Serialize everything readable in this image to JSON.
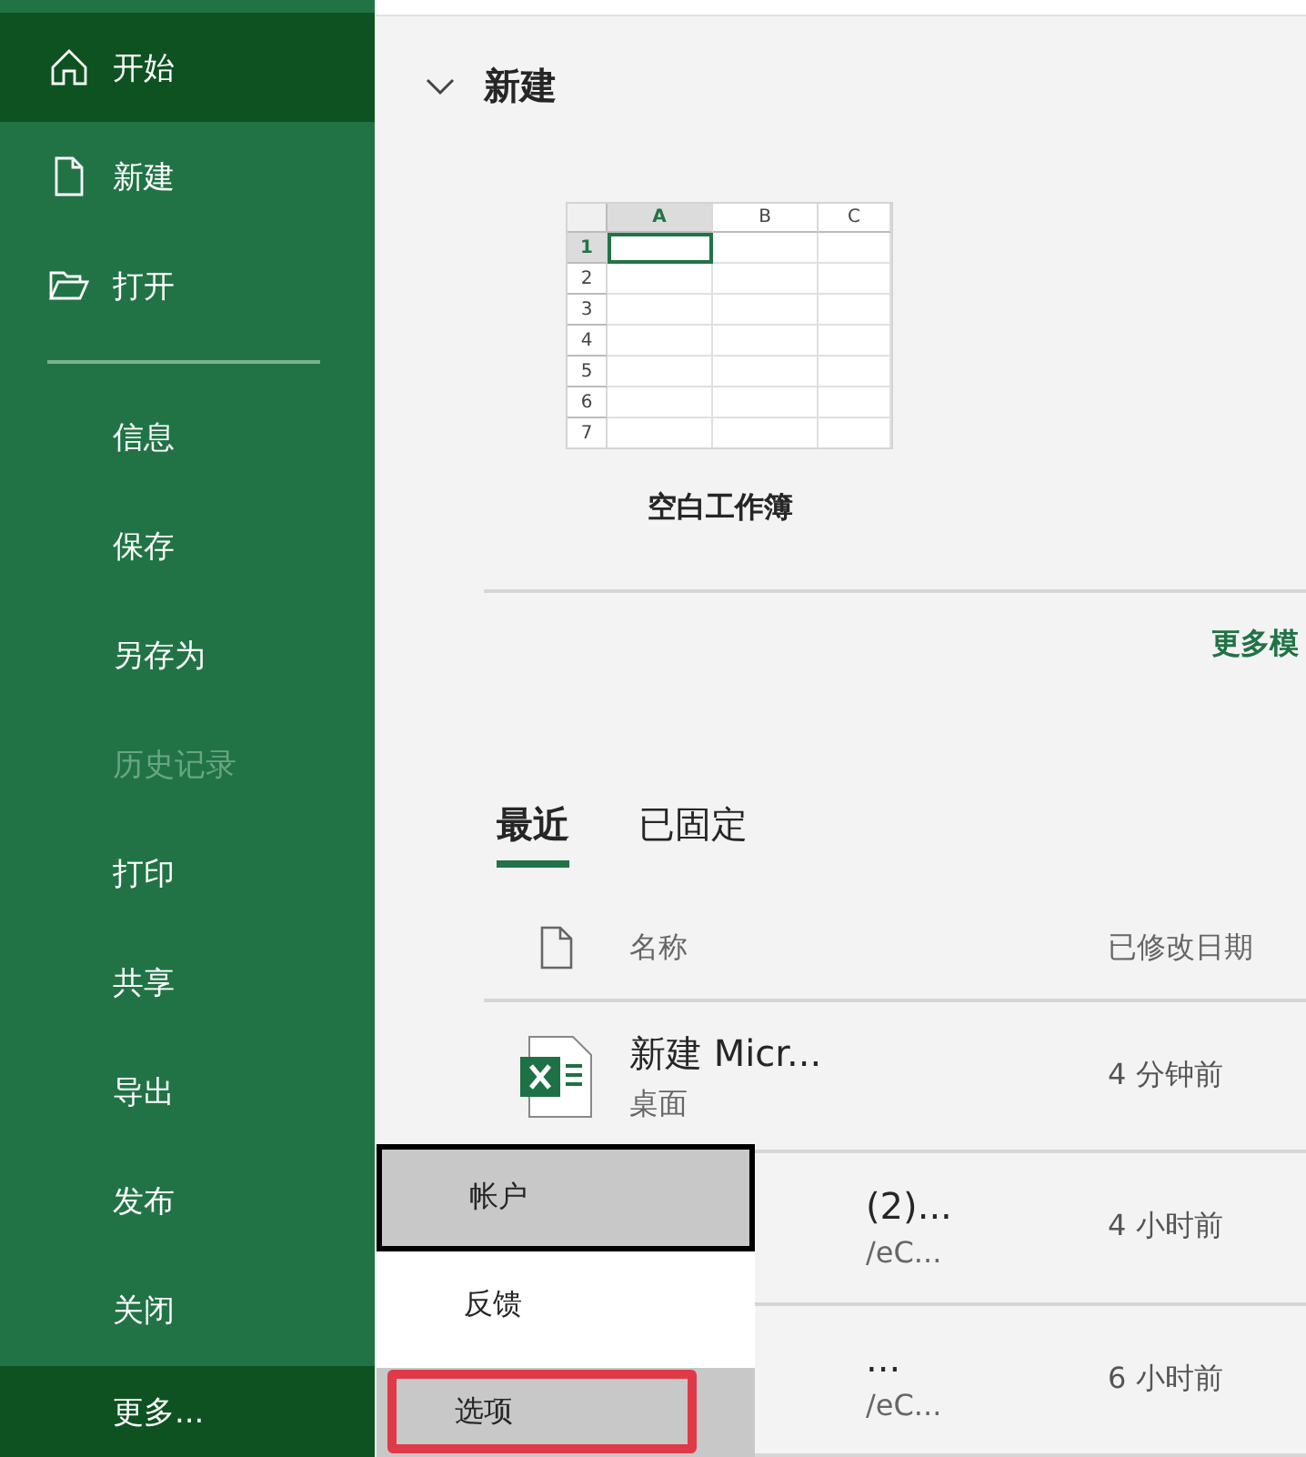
{
  "sidebar": {
    "items": [
      {
        "label": "开始",
        "selected": true,
        "disabled": false
      },
      {
        "label": "新建",
        "selected": false,
        "disabled": false
      },
      {
        "label": "打开",
        "selected": false,
        "disabled": false
      },
      {
        "label": "信息",
        "selected": false,
        "disabled": false,
        "divider_before": true
      },
      {
        "label": "保存",
        "selected": false,
        "disabled": false
      },
      {
        "label": "另存为",
        "selected": false,
        "disabled": false
      },
      {
        "label": "历史记录",
        "selected": false,
        "disabled": true
      },
      {
        "label": "打印",
        "selected": false,
        "disabled": false
      },
      {
        "label": "共享",
        "selected": false,
        "disabled": false
      },
      {
        "label": "导出",
        "selected": false,
        "disabled": false
      },
      {
        "label": "发布",
        "selected": false,
        "disabled": false
      },
      {
        "label": "关闭",
        "selected": false,
        "disabled": false
      },
      {
        "label": "更多...",
        "selected": true,
        "disabled": false
      }
    ]
  },
  "new_section": {
    "title": "新建",
    "expanded": true,
    "template": {
      "label": "空白工作簿",
      "columns": [
        "A",
        "B",
        "C"
      ],
      "rows": [
        "1",
        "2",
        "3",
        "4",
        "5",
        "6",
        "7"
      ]
    },
    "more_link": "更多模"
  },
  "tabs": [
    {
      "label": "最近",
      "selected": true
    },
    {
      "label": "已固定",
      "selected": false
    }
  ],
  "file_list": {
    "columns": [
      "名称",
      "已修改日期"
    ],
    "rows": [
      {
        "name": "新建 Micr...",
        "location": "桌面",
        "modified": "4 分钟前",
        "covered": false
      },
      {
        "name": "(2)...",
        "location": "/eC...",
        "modified": "4 小时前",
        "covered": true
      },
      {
        "name": "...",
        "location": "/eC...",
        "modified": "6 小时前",
        "covered": true
      }
    ]
  },
  "popup_menu": {
    "items": [
      {
        "label": "帐户",
        "selected": true,
        "highlighted": false
      },
      {
        "label": "反馈",
        "selected": false,
        "highlighted": false
      },
      {
        "label": "选项",
        "selected": false,
        "highlighted": true
      }
    ]
  }
}
